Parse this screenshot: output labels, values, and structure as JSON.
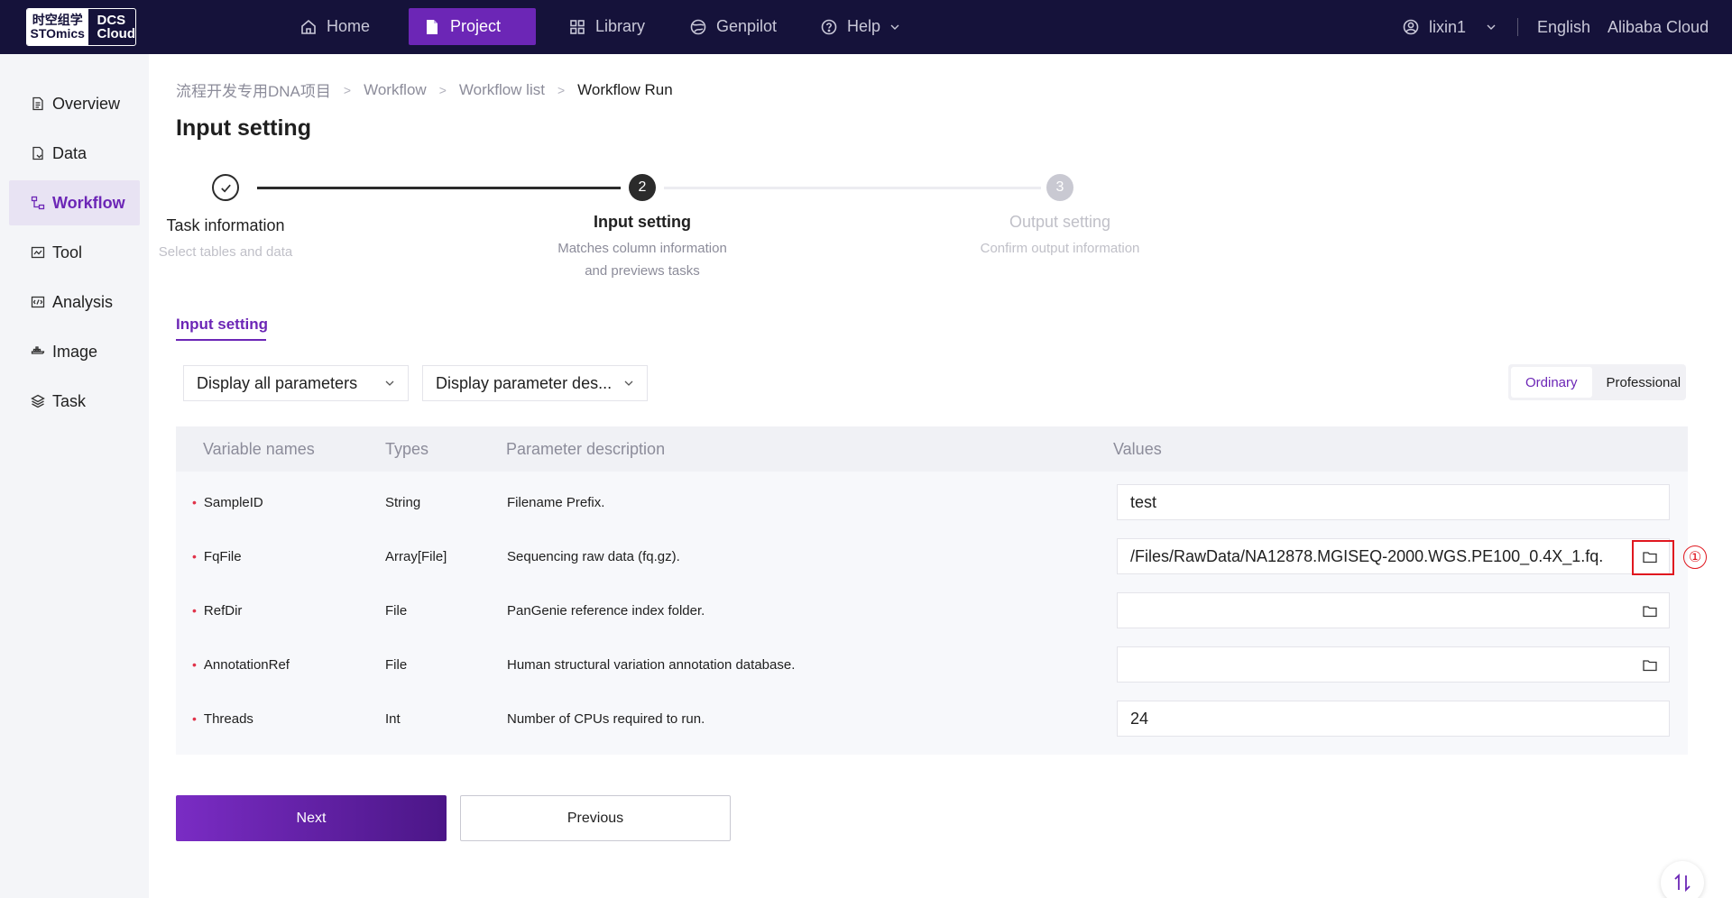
{
  "brand": {
    "logo_cn_top": "时空组学",
    "logo_cn_bottom": "STOmics",
    "logo_en_top": "DCS",
    "logo_en_bottom": "Cloud"
  },
  "topnav": {
    "items": [
      {
        "label": "Home",
        "icon": "home-icon"
      },
      {
        "label": "Project",
        "icon": "file-icon"
      },
      {
        "label": "Library",
        "icon": "grid-icon"
      },
      {
        "label": "Genpilot",
        "icon": "globe-icon"
      },
      {
        "label": "Help",
        "icon": "help-icon"
      }
    ],
    "user": "lixin1",
    "language": "English",
    "cloud": "Alibaba Cloud"
  },
  "sidebar": {
    "items": [
      {
        "label": "Overview",
        "icon": "document-icon"
      },
      {
        "label": "Data",
        "icon": "data-icon"
      },
      {
        "label": "Workflow",
        "icon": "workflow-icon"
      },
      {
        "label": "Tool",
        "icon": "tool-icon"
      },
      {
        "label": "Analysis",
        "icon": "analysis-icon"
      },
      {
        "label": "Image",
        "icon": "image-icon"
      },
      {
        "label": "Task",
        "icon": "task-icon"
      }
    ]
  },
  "breadcrumb": [
    "流程开发专用DNA项目",
    "Workflow",
    "Workflow list",
    "Workflow Run"
  ],
  "page_title": "Input setting",
  "steps": [
    {
      "title": "Task information",
      "desc1": "Select tables and data",
      "desc2": "",
      "marker": ""
    },
    {
      "title": "Input setting",
      "desc1": "Matches column information",
      "desc2": "and previews tasks",
      "marker": "2"
    },
    {
      "title": "Output setting",
      "desc1": "Confirm output information",
      "desc2": "",
      "marker": "3"
    }
  ],
  "tab": "Input setting",
  "filters": {
    "param_display": "Display all parameters",
    "desc_display": "Display parameter des..."
  },
  "mode": {
    "ordinary": "Ordinary",
    "professional": "Professional"
  },
  "table": {
    "headers": [
      "Variable names",
      "Types",
      "Parameter description",
      "Values"
    ],
    "rows": [
      {
        "name": "SampleID",
        "type": "String",
        "desc": "Filename Prefix.",
        "value": "test"
      },
      {
        "name": "FqFile",
        "type": "Array[File]",
        "desc": "Sequencing raw data (fq.gz).",
        "value": "/Files/RawData/NA12878.MGISEQ-2000.WGS.PE100_0.4X_1.fq."
      },
      {
        "name": "RefDir",
        "type": "File",
        "desc": "PanGenie reference index folder.",
        "value": ""
      },
      {
        "name": "AnnotationRef",
        "type": "File",
        "desc": "Human structural variation annotation database.",
        "value": ""
      },
      {
        "name": "Threads",
        "type": "Int",
        "desc": "Number of CPUs required to run.",
        "value": "24"
      }
    ],
    "required_mark": "•"
  },
  "annotation_marker": "①",
  "buttons": {
    "next": "Next",
    "previous": "Previous"
  },
  "colors": {
    "accent": "#6c26b6",
    "topbar": "#15123a",
    "highlight": "#e0171f"
  }
}
